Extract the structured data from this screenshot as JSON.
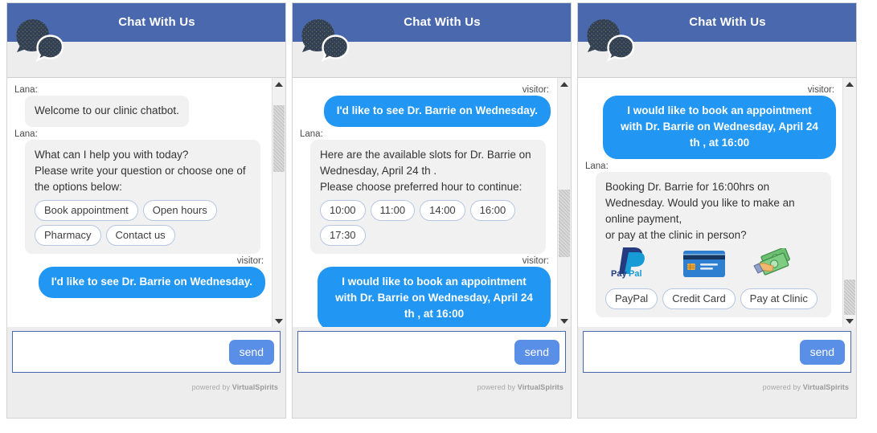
{
  "widget": {
    "header_title": "Chat With Us",
    "logo_icon": "chat-bubbles-icon",
    "bot_name_label": "Lana:",
    "visitor_name_label": "visitor:",
    "input_placeholder": "",
    "input_value": "",
    "send_label": "send",
    "footer_powered_prefix": "powered by ",
    "footer_powered_brand": "VirtualSpirits",
    "colors": {
      "header_blue": "#4a68ad",
      "user_bubble_blue": "#2196f3",
      "bot_bubble_gray": "#f1f1f1",
      "send_button_blue": "#5a8fe8",
      "option_border": "#b7c6e2",
      "shell_gray": "#ededed"
    }
  },
  "panels": [
    {
      "id": "panel-1-welcome",
      "scroll_thumb_top_pct": 6,
      "scroll_thumb_height_pct": 27,
      "messages": [
        {
          "from": "bot",
          "speaker": "Lana:",
          "text": "Welcome to our clinic chatbot.",
          "options": []
        },
        {
          "from": "bot",
          "speaker": "Lana:",
          "text": "What can I help you with today?\nPlease write your question or choose one of the options below:",
          "options": [
            "Book appointment",
            "Open hours",
            "Pharmacy",
            "Contact us"
          ]
        },
        {
          "from": "visitor",
          "speaker": "visitor:",
          "text": "I'd like to see Dr. Barrie on Wednesday.",
          "options": []
        }
      ]
    },
    {
      "id": "panel-2-slots",
      "scroll_thumb_top_pct": 40,
      "scroll_thumb_height_pct": 27,
      "messages": [
        {
          "from": "visitor",
          "speaker": "visitor:",
          "text": "I'd like to see Dr. Barrie on Wednesday.",
          "options": []
        },
        {
          "from": "bot",
          "speaker": "Lana:",
          "text": "Here are the available slots for Dr. Barrie on Wednesday, April 24 th .\nPlease choose preferred hour to continue:",
          "options": [
            "10:00",
            "11:00",
            "14:00",
            "16:00",
            "17:30"
          ]
        },
        {
          "from": "visitor",
          "speaker": "visitor:",
          "text": "I would like to book an appointment with Dr. Barrie on Wednesday, April 24 th , at 16:00",
          "options": []
        }
      ]
    },
    {
      "id": "panel-3-payment",
      "scroll_thumb_top_pct": 76,
      "scroll_thumb_height_pct": 22,
      "messages": [
        {
          "from": "visitor",
          "speaker": "visitor:",
          "text": "I would like to book an appointment with Dr. Barrie on Wednesday, April 24 th , at 16:00",
          "options": []
        },
        {
          "from": "bot",
          "speaker": "Lana:",
          "text": "Booking Dr. Barrie for 16:00hrs on Wednesday. Would you like to make an online payment,\nor pay at the clinic in person?",
          "payment_icons": [
            "paypal-icon",
            "credit-card-icon",
            "cash-in-hand-icon"
          ],
          "options": [
            "PayPal",
            "Credit Card",
            "Pay at Clinic"
          ]
        }
      ]
    }
  ]
}
